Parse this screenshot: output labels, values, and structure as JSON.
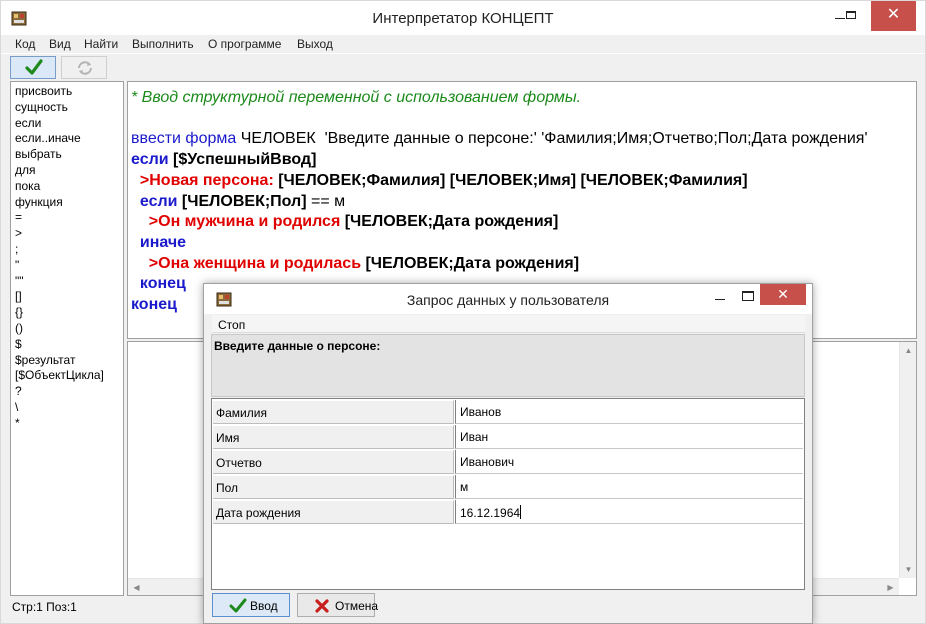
{
  "window": {
    "title": "Интерпретатор КОНЦЕПТ",
    "close_glyph": "✕"
  },
  "menu": [
    "Код",
    "Вид",
    "Найти",
    "Выполнить",
    "О программе",
    "Выход"
  ],
  "keywords": [
    "присвоить",
    "сущность",
    "если",
    "если..иначе",
    "выбрать",
    "для",
    "пока",
    "функция",
    "=",
    ">",
    ";",
    "\"",
    "\"\"",
    "[]",
    "{}",
    "()",
    "$",
    "$результат",
    "[$ОбъектЦикла]",
    "?",
    "\\",
    "*"
  ],
  "code": {
    "line1": "* Ввод структурной переменной с использованием формы.",
    "line3_kw": "ввести форма",
    "line3_rest": " ЧЕЛОВЕК  'Введите данные о персоне:' 'Фамилия;Имя;Отчетво;Пол;Дата рождения'",
    "line4_kw": "если",
    "line4_rest": " [$УспешныйВвод]",
    "line5_red": "  >Новая персона:",
    "line5_rest": " [ЧЕЛОВЕК;Фамилия] [ЧЕЛОВЕК;Имя] [ЧЕЛОВЕК;Фамилия]",
    "line6_kw": "  если",
    "line6_b": " [ЧЕЛОВЕК;Пол]",
    "line6_rest": " == м",
    "line7_red": "    >Он мужчина и родился",
    "line7_rest": " [ЧЕЛОВЕК;Дата рождения]",
    "line8_kw": "  иначе",
    "line9_red": "    >Она женщина и родилась",
    "line9_rest": " [ЧЕЛОВЕК;Дата рождения]",
    "line10_kw": "  конец",
    "line11_kw": "конец"
  },
  "status": "Стр:1 Поз:1",
  "dialog": {
    "title": "Запрос данных у пользователя",
    "close_glyph": "✕",
    "menu_stop": "Стоп",
    "prompt": "Введите данные о персоне:",
    "fields": [
      {
        "label": "Фамилия",
        "value": "Иванов"
      },
      {
        "label": "Имя",
        "value": "Иван"
      },
      {
        "label": "Отчетво",
        "value": "Иванович"
      },
      {
        "label": "Пол",
        "value": "м"
      },
      {
        "label": "Дата рождения",
        "value": "16.12.1964"
      }
    ],
    "ok_label": "Ввод",
    "cancel_label": "Отмена"
  },
  "colors": {
    "comment": "#1b8a1b",
    "keyword": "#1a1acc",
    "message": "#e00000",
    "close_button": "#c7504b"
  }
}
